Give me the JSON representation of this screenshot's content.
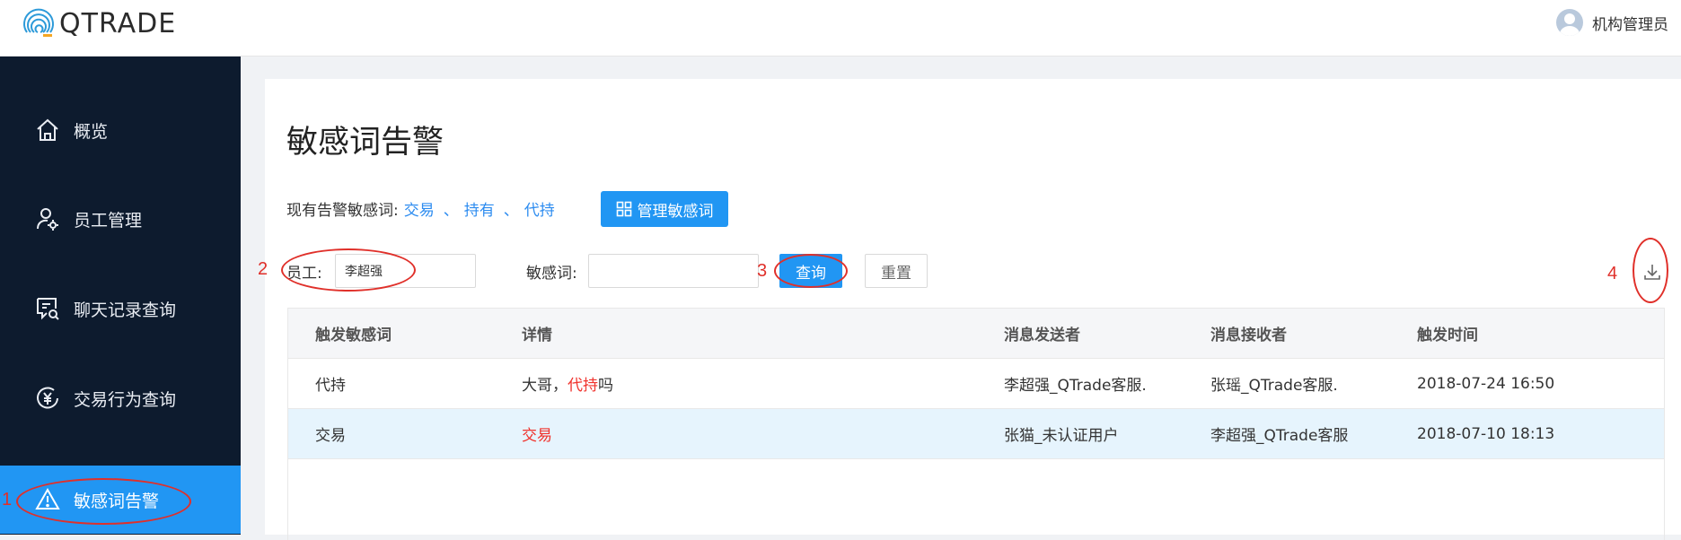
{
  "header": {
    "logo_text": "QTRADE",
    "user_name": "机构管理员"
  },
  "sidebar": {
    "items": [
      {
        "label": "概览",
        "icon": "home-icon"
      },
      {
        "label": "员工管理",
        "icon": "user-gear-icon"
      },
      {
        "label": "聊天记录查询",
        "icon": "chat-search-icon"
      },
      {
        "label": "交易行为查询",
        "icon": "yuan-icon"
      },
      {
        "label": "敏感词告警",
        "icon": "warning-icon",
        "active": true
      }
    ]
  },
  "main": {
    "title": "敏感词告警",
    "keywords_label": "现有告警敏感词:",
    "keywords": [
      "交易",
      "持有",
      "代持"
    ],
    "keyword_separator": "、",
    "manage_button": "管理敏感词",
    "filters": {
      "employee_label": "员工:",
      "employee_value": "李超强",
      "keyword_label": "敏感词:",
      "keyword_value": ""
    },
    "query_button": "查询",
    "reset_button": "重置"
  },
  "table": {
    "headers": [
      "触发敏感词",
      "详情",
      "消息发送者",
      "消息接收者",
      "触发时间"
    ],
    "rows": [
      {
        "word": "代持",
        "detail_prefix": "大哥，",
        "detail_highlight": "代持",
        "detail_suffix": "吗",
        "sender": "李超强_QTrade客服.",
        "receiver": "张瑶_QTrade客服.",
        "time": "2018-07-24 16:50"
      },
      {
        "word": "交易",
        "detail_prefix": "",
        "detail_highlight": "交易",
        "detail_suffix": "",
        "sender": "张猫_未认证用户",
        "receiver": "李超强_QTrade客服",
        "time": "2018-07-10 18:13"
      }
    ]
  },
  "annotations": [
    "1",
    "2",
    "3",
    "4"
  ],
  "colors": {
    "sidebar_bg": "#0d1b2e",
    "accent": "#2196f3",
    "highlight": "#f0322c",
    "annotation": "#e0302a"
  }
}
